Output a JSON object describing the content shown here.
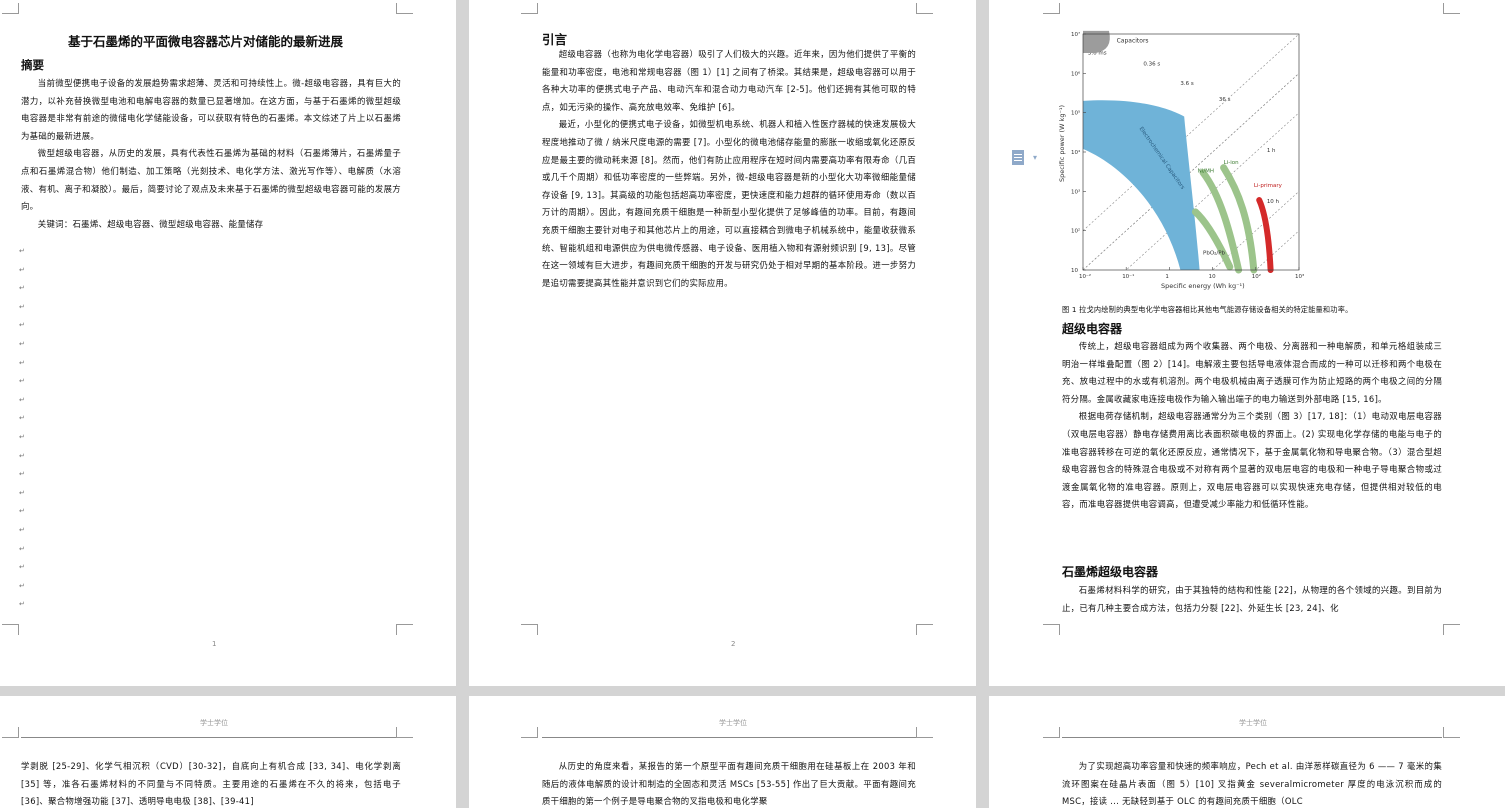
{
  "page1": {
    "title": "基于石墨烯的平面微电容器芯片对储能的最新进展",
    "abstract_heading": "摘要",
    "para1": "当前微型便携电子设备的发展趋势需求超薄、灵活和可持续性上。微-超级电容器，具有巨大的潜力，以补充替换微型电池和电解电容器的数量已显著增加。在这方面，与基于石墨烯的微型超级电容器是非常有前途的微储电化学储能设备，可以获取有特色的石墨烯。本文综述了片上以石墨烯为基础的最新进展。",
    "para2": "微型超级电容器，从历史的发展，具有代表性石墨烯为基础的材料（石墨烯薄片，石墨烯量子点和石墨烯混合物）他们制造、加工策略（光刻技术、电化学方法、激光写作等）、电解质（水溶液、有机、离子和凝胶）。最后，简要讨论了观点及未来基于石墨烯的微型超级电容器可能的发展方向。",
    "keywords": "关键词：石墨烯、超级电容器、微型超级电容器、能量储存",
    "page_number": "1"
  },
  "page2": {
    "heading": "引言",
    "para1": "超级电容器（也称为电化学电容器）吸引了人们极大的兴趣。近年来，因为他们提供了平衡的能量和功率密度，电池和常规电容器（图 1）[1] 之间有了桥梁。其结果是，超级电容器可以用于各种大功率的便携式电子产品、电动汽车和混合动力电动汽车 [2-5]。他们还拥有其他可取的特点，如无污染的操作、高充放电效率、免维护 [6]。",
    "para2": "最近，小型化的便携式电子设备，如微型机电系统、机器人和植入性医疗器械的快速发展极大程度地推动了微 / 纳米尺度电源的需要 [7]。小型化的微电池储存能量的膨胀一收缩或氧化还原反应是最主要的微动耗来源 [8]。然而，他们有防止应用程序在短时间内需要高功率有限寿命（几百或几千个周期）和低功率密度的一些弊端。另外，微-超级电容器是新的小型化大功率微细能量储存设备 [9, 13]。其高级的功能包括超高功率密度，更快速度和能力超群的循环使用寿命（数以百万计的周期）。因此，有趣间充质干细胞是一种新型小型化提供了足够峰值的功率。目前，有趣间充质干细胞主要针对电子和其他芯片上的用途，可以直接耦合到微电子机械系统中，能量收获微系统、智能机组和电源供应为供电微传感器、电子设备、医用植入物和有源射频识别 [9, 13]。尽管在这一领域有巨大进步，有趣间充质干细胞的开发与研究仍处于相对早期的基本阶段。进一步努力是追切需要提高其性能并意识到它们的实际应用。",
    "page_number": "2"
  },
  "page3": {
    "caption": "图 1 拉戈内绘制的典型电化学电容器相比其他电气能源存储设备相关的特定能量和功率。",
    "heading1": "超级电容器",
    "para1": "传统上，超级电容器组成为两个收集器、两个电极、分离器和一种电解质，和单元格组装成三明治一样堆叠配置（图 2）[14]。电解液主要包括导电液体混合而成的一种可以迁移和两个电极在充、放电过程中的水或有机溶剂。两个电极机械由离子透膜可作为防止短路的两个电极之间的分隔符分隔。金属收藏家电连接电极作为输入输出端子的电力输送到外部电路 [15, 16]。",
    "para2": "根据电荷存储机制，超级电容器通常分为三个类别（图 3）[17, 18]：（1）电动双电层电容器（双电层电容器）静电存储费用离比表面积碳电极的界面上。(2) 实现电化学存储的电能与电子的准电容器转移在可逆的氧化还原反应，通常情况下，基于金属氧化物和导电聚合物。（3）混合型超级电容器包含的特殊混合电极或不对称有两个显著的双电层电容的电极和一种电子导电聚合物或过渡金属氧化物的准电容器。原则上，双电层电容器可以实现快速充电存储，但提供相对较低的电容，而准电容器提供电容调高，但遭受减少率能力和低循环性能。",
    "heading2": "石墨烯超级电容器",
    "para3": "石墨烯材料科学的研究，由于其独特的结构和性能 [22]，从物理的各个领域的兴趣。到目前为止，已有几种主要合成方法，包括力分裂 [22]、外延生长 [23, 24]、化"
  },
  "chart_data": {
    "type": "scatter",
    "subtype": "ragone-region-plot",
    "title": "",
    "xlabel": "Specific energy (Wh kg⁻¹)",
    "ylabel": "Specific power (W kg⁻¹)",
    "x_scale": "log",
    "y_scale": "log",
    "x_ticks": [
      "10⁻²",
      "10⁻¹",
      "1",
      "10",
      "10²",
      "10³"
    ],
    "y_ticks": [
      "10",
      "10²",
      "10³",
      "10⁴",
      "10⁵",
      "10⁶",
      "10⁷"
    ],
    "xlim": [
      0.01,
      1000
    ],
    "ylim": [
      10,
      10000000
    ],
    "series": [
      {
        "name": "Capacitors",
        "color": "#9c9c9c"
      },
      {
        "name": "Electrochemical Capacitors",
        "color": "#6fb3d8"
      },
      {
        "name": "Ni/MH",
        "color": "#9cc48b"
      },
      {
        "name": "Li-ion",
        "color": "#9cc48b"
      },
      {
        "name": "PbO₂/Pb",
        "color": "#9cc48b"
      },
      {
        "name": "Li-primary",
        "color": "#d42a2a"
      }
    ],
    "time_lines": [
      "3.6 ms",
      "0.36 s",
      "3.6 s",
      "36 s",
      "1 h",
      "10 h"
    ]
  },
  "page4": {
    "header": "学士学位",
    "text": "学剥脱 [25-29]、化学气相沉积（CVD）[30-32]，自底向上有机合成 [33, 34]、电化学剥离 [35] 等，准各石墨烯材料的不同量与不同特质。主要用途的石墨烯在不久的将来，包括电子 [36]、聚合物增强功能 [37]、透明导电电极 [38]、[39-41]"
  },
  "page5": {
    "header": "学士学位",
    "text": "从历史的角度来看，某报告的第一个原型平面有趣间充质干细胞用在硅基板上在 2003 年和随后的液体电解质的设计和制造的全固态和灵活 MSCs [53-55] 作出了巨大贡献。平面有趣间充质干细胞的第一个例子是导电聚合物的叉指电极和电化学聚"
  },
  "page6": {
    "header": "学士学位",
    "text": "为了实现超高功率容量和快速的频率响应，Pech et al. 由洋葱样碳直径为 6 —— 7 毫米的集流环图案在硅晶片表面（图 5）[10] 叉指黄金 severalmicrometer 厚度的电泳沉积而成的 MSC，接读 ... 无缺轻到基于 OLC 的有趣间充质干细胞（OLC"
  }
}
